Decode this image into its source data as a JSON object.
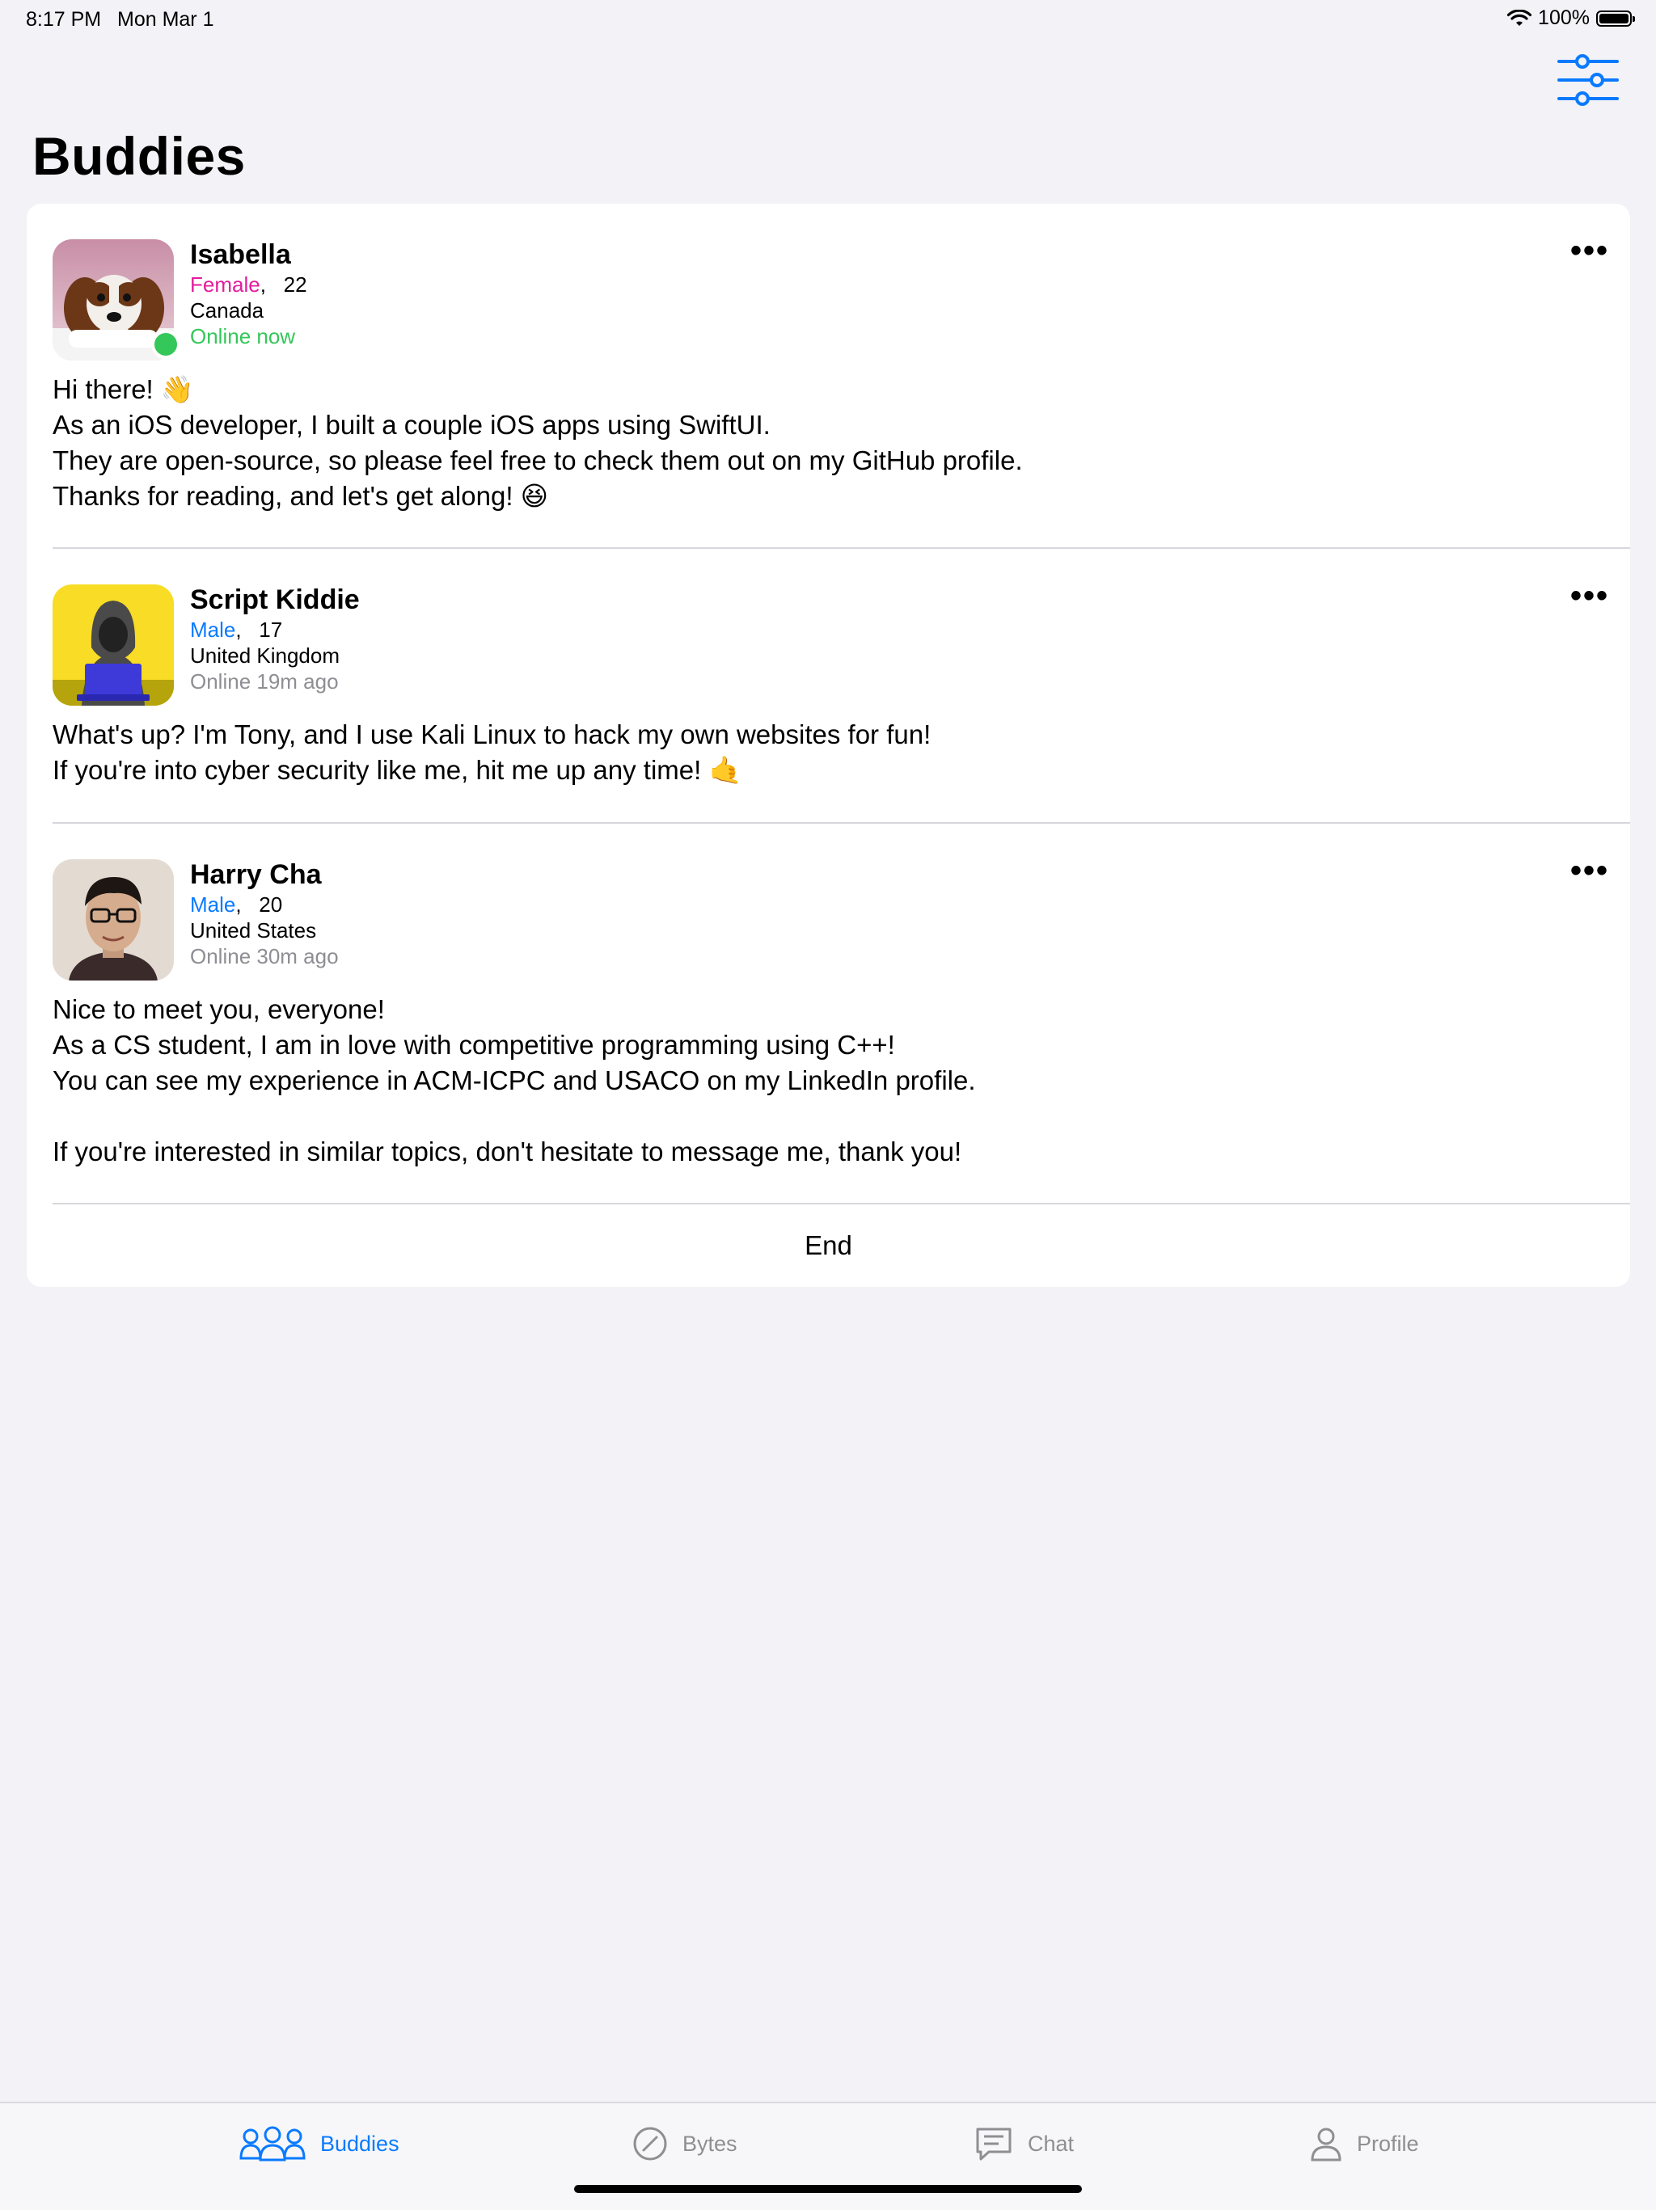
{
  "status_bar": {
    "time": "8:17 PM",
    "date": "Mon Mar 1",
    "battery": "100%"
  },
  "header": {
    "title": "Buddies"
  },
  "posts": [
    {
      "name": "Isabella",
      "gender": "Female",
      "age": "22",
      "country": "Canada",
      "status": "Online now",
      "bio": "Hi there! 👋\nAs an iOS developer, I built a couple iOS apps using SwiftUI.\nThey are open-source, so please feel free to check them out on my GitHub profile.\nThanks for reading, and let's get along! 😆"
    },
    {
      "name": "Script Kiddie",
      "gender": "Male",
      "age": "17",
      "country": "United Kingdom",
      "status": "Online 19m ago",
      "bio": "What's up? I'm Tony, and I use Kali Linux to hack my own websites for fun!\nIf you're into cyber security like me, hit me up any time! 🤙"
    },
    {
      "name": "Harry Cha",
      "gender": "Male",
      "age": "20",
      "country": "United States",
      "status": "Online 30m ago",
      "bio": "Nice to meet you, everyone!\nAs a CS student, I am in love with competitive programming using C++!\nYou can see my experience in ACM-ICPC and USACO on my LinkedIn profile.\n\nIf you're interested in similar topics, don't hesitate to message me, thank you!"
    }
  ],
  "list_end_label": "End",
  "more_glyph": "•••",
  "separator": ",",
  "tabs": [
    {
      "label": "Buddies",
      "icon": "people-icon",
      "active": true
    },
    {
      "label": "Bytes",
      "icon": "compass-icon",
      "active": false
    },
    {
      "label": "Chat",
      "icon": "chat-bubble-icon",
      "active": false
    },
    {
      "label": "Profile",
      "icon": "person-icon",
      "active": false
    }
  ],
  "colors": {
    "accent": "#0a7aff",
    "female": "#e21d9c",
    "online": "#34c759",
    "inactive": "#8e8e93"
  }
}
